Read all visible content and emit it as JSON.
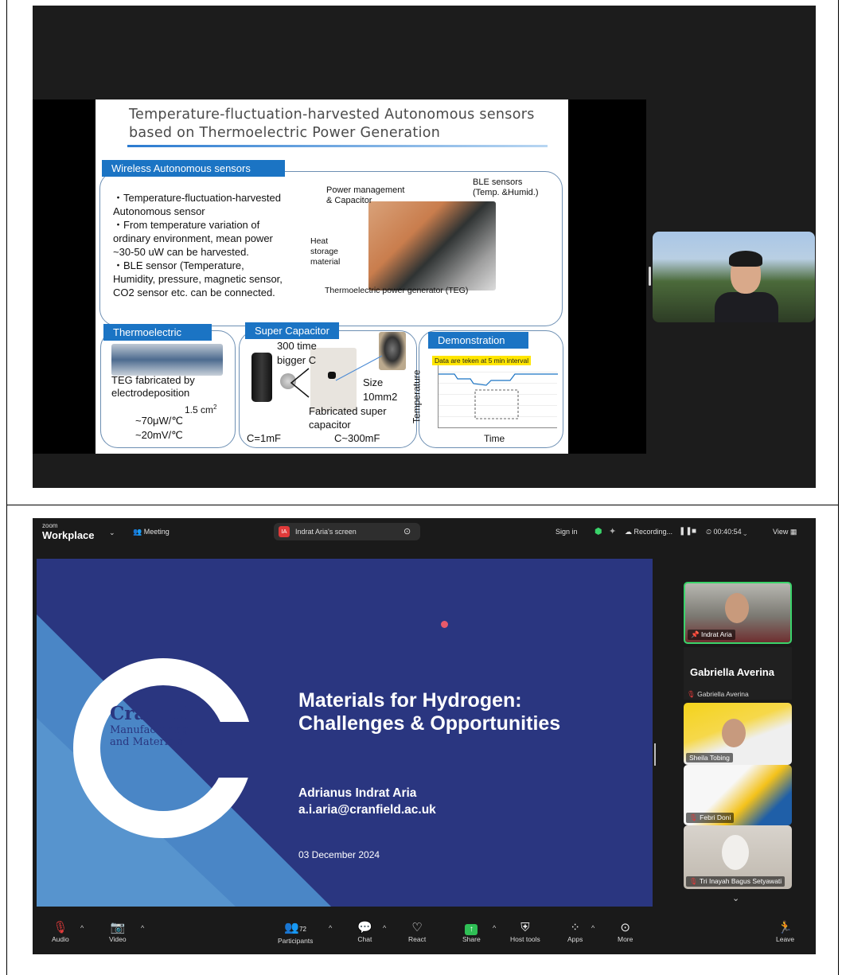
{
  "top": {
    "slide": {
      "title": "Temperature-fluctuation-harvested Autonomous sensors based on Thermoelectric Power Generation",
      "section_tag": "Wireless Autonomous sensors",
      "bullets": [
        "・Temperature-fluctuation-harvested",
        "Autonomous sensor",
        "・From temperature variation of",
        "ordinary environment, mean power",
        "~30-50  uW can be harvested.",
        "・BLE sensor (Temperature,",
        "Humidity, pressure, magnetic sensor,",
        "CO2 sensor etc. can be connected."
      ],
      "label_power": "Power management",
      "label_power2": "& Capacitor",
      "label_ble": "BLE sensors",
      "label_ble2": "(Temp. &Humid.)",
      "label_heat": "Heat",
      "label_heat2": "storage",
      "label_heat3": "material",
      "label_teg": "Thermoelectric power generator (TEG)",
      "tag_thermo": "Thermoelectric",
      "teg_line1": "TEG fabricated by",
      "teg_line2": "electrodeposition",
      "teg_area": "1.5 cm",
      "teg_area_sup": "2",
      "teg_uw": "~70μW/℃",
      "teg_mv": "~20mV/℃",
      "tag_sc": "Super Capacitor",
      "sc_300": "300 time",
      "sc_bigger": "bigger  C",
      "sc_size": "Size",
      "sc_size2": "10mm2",
      "sc_fab": "Fabricated super",
      "sc_fab2": "capacitor",
      "sc_c1": "C=1mF",
      "sc_c2": "C~300mF",
      "tag_demo": "Demonstration",
      "demo_note": "Data are teken at 5 min interval",
      "demo_ylabel": "Temperature",
      "demo_xlabel": "Time"
    }
  },
  "zoom": {
    "logo_small": "zoom",
    "logo_big": "Workplace",
    "meeting_label": "Meeting",
    "share_badge": "IA",
    "share_label": "Indrat Aria's screen",
    "sign_in": "Sign in",
    "recording": "Recording...",
    "timer": "00:40:54",
    "view": "View",
    "slide": {
      "logo_line1": "Cranfield",
      "logo_line2": "Manufacturing",
      "logo_line3": "and Materials",
      "title_line1": "Materials for Hydrogen:",
      "title_line2": "Challenges & Opportunities",
      "author": "Adrianus Indrat Aria",
      "email": "a.i.aria@cranfield.ac.uk",
      "date": "03 December 2024"
    },
    "gallery": [
      {
        "name": "Indrat Aria"
      },
      {
        "name": "Gabriella Averina",
        "big": "Gabriella Averina"
      },
      {
        "name": "Sheila Tobing"
      },
      {
        "name": "Febri Doni"
      },
      {
        "name": "Tri Inayah Bagus Setyawati"
      }
    ],
    "toolbar": {
      "audio": "Audio",
      "video": "Video",
      "participants": "Participants",
      "participants_count": "72",
      "chat": "Chat",
      "react": "React",
      "share": "Share",
      "host_tools": "Host tools",
      "apps": "Apps",
      "more": "More",
      "leave": "Leave"
    }
  }
}
